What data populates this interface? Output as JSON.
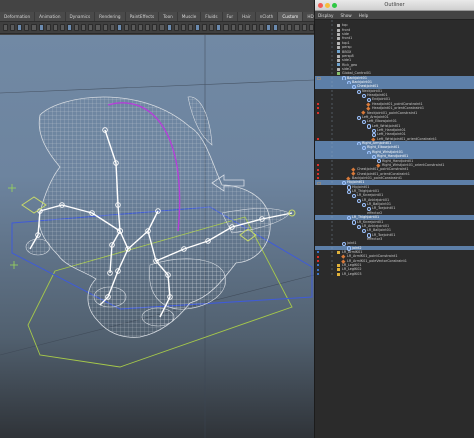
{
  "maya": {
    "shelf_tabs": [
      {
        "label": "Deformation",
        "active": false
      },
      {
        "label": "Animation",
        "active": false
      },
      {
        "label": "Dynamics",
        "active": false
      },
      {
        "label": "Rendering",
        "active": false
      },
      {
        "label": "PaintEffects",
        "active": false
      },
      {
        "label": "Toon",
        "active": false
      },
      {
        "label": "Muscle",
        "active": false
      },
      {
        "label": "Fluids",
        "active": false
      },
      {
        "label": "Fur",
        "active": false
      },
      {
        "label": "Hair",
        "active": false
      },
      {
        "label": "nCloth",
        "active": false
      },
      {
        "label": "Custom",
        "active": true
      },
      {
        "label": "HDRLightStudio",
        "active": false
      }
    ],
    "viewport": {
      "bg_top": "#7189a4",
      "bg_bottom": "#2f3338",
      "mesh_color": "#c9ced4",
      "joint_color": "#ffffff",
      "control_green": "#c7d96a",
      "control_blue": "#3f5bd8",
      "control_purple": "#b43fd8"
    }
  },
  "outliner": {
    "title": "Outliner",
    "menu": [
      "Display",
      "Show",
      "Help"
    ],
    "selection_color": "#5d7fa8",
    "rows": [
      {
        "label": "",
        "indent": 0,
        "icon": "none",
        "mk": "",
        "sel": false
      },
      {
        "label": "top",
        "indent": 0,
        "icon": "cam",
        "mk": "",
        "sel": false
      },
      {
        "label": "front",
        "indent": 0,
        "icon": "cam",
        "mk": "",
        "sel": false
      },
      {
        "label": "side",
        "indent": 0,
        "icon": "cam",
        "mk": "",
        "sel": false
      },
      {
        "label": "front1",
        "indent": 0,
        "icon": "cam",
        "mk": "",
        "sel": false
      },
      {
        "label": "top1",
        "indent": 0,
        "icon": "cam",
        "mk": "",
        "sel": false
      },
      {
        "label": "persp",
        "indent": 0,
        "icon": "cam",
        "mk": "",
        "sel": false
      },
      {
        "label": "BBOX",
        "indent": 0,
        "icon": "mesh",
        "mk": "",
        "sel": false
      },
      {
        "label": "persp8",
        "indent": 0,
        "icon": "cam",
        "mk": "",
        "sel": false
      },
      {
        "label": "side1",
        "indent": 0,
        "icon": "cam",
        "mk": "",
        "sel": false
      },
      {
        "label": "Rick_geo",
        "indent": 0,
        "icon": "mesh",
        "mk": "",
        "sel": false
      },
      {
        "label": "side1",
        "indent": 0,
        "icon": "cam",
        "mk": "",
        "sel": false
      },
      {
        "label": "Global_Control01",
        "indent": 0,
        "icon": "ctrl",
        "mk": "",
        "sel": false
      },
      {
        "label": "Backjoint01",
        "indent": 1,
        "icon": "joint",
        "mk": "box",
        "sel": true
      },
      {
        "label": "Backjoint01",
        "indent": 2,
        "icon": "joint",
        "mk": "",
        "sel": true
      },
      {
        "label": "Chestjoint01",
        "indent": 3,
        "icon": "joint",
        "mk": "",
        "sel": true
      },
      {
        "label": "Neckjoint01",
        "indent": 4,
        "icon": "joint",
        "mk": "",
        "sel": false
      },
      {
        "label": "Headjoint01",
        "indent": 5,
        "icon": "joint",
        "mk": "",
        "sel": false
      },
      {
        "label": "Endjoint01",
        "indent": 6,
        "icon": "joint",
        "mk": "",
        "sel": false
      },
      {
        "label": "Headjoint01_pointConstraint1",
        "indent": 6,
        "icon": "con",
        "mk": "red",
        "sel": false
      },
      {
        "label": "Headjoint01_orientConstraint1",
        "indent": 6,
        "icon": "con",
        "mk": "red",
        "sel": false
      },
      {
        "label": "Neckjoint01_pointConstraint1",
        "indent": 5,
        "icon": "con",
        "mk": "red",
        "sel": false
      },
      {
        "label": "Left_Armjoint01",
        "indent": 4,
        "icon": "joint",
        "mk": "",
        "sel": false
      },
      {
        "label": "Left_Elbowjoint01",
        "indent": 5,
        "icon": "joint",
        "mk": "",
        "sel": false
      },
      {
        "label": "Left_Wristjoint01",
        "indent": 6,
        "icon": "joint",
        "mk": "",
        "sel": false
      },
      {
        "label": "Left_Handjoint01",
        "indent": 7,
        "icon": "joint",
        "mk": "",
        "sel": false
      },
      {
        "label": "Left_Handjoint01",
        "indent": 7,
        "icon": "joint",
        "mk": "",
        "sel": false
      },
      {
        "label": "Left_Wristjoint01_orientConstraint1",
        "indent": 7,
        "icon": "con",
        "mk": "red",
        "sel": false
      },
      {
        "label": "Right_Armjoint01",
        "indent": 4,
        "icon": "joint",
        "mk": "",
        "sel": true
      },
      {
        "label": "Right_Elbowjoint01",
        "indent": 5,
        "icon": "joint",
        "mk": "",
        "sel": true
      },
      {
        "label": "Right_Wristjoint01",
        "indent": 6,
        "icon": "joint",
        "mk": "",
        "sel": true
      },
      {
        "label": "Right_Handjoint01",
        "indent": 7,
        "icon": "joint",
        "mk": "",
        "sel": true
      },
      {
        "label": "Right_Handjoint01",
        "indent": 8,
        "icon": "joint",
        "mk": "",
        "sel": false
      },
      {
        "label": "Right_Wristjoint01_orientConstraint1",
        "indent": 8,
        "icon": "con",
        "mk": "red",
        "sel": false
      },
      {
        "label": "Chestjoint01_pointConstraint1",
        "indent": 3,
        "icon": "con",
        "mk": "red",
        "sel": false
      },
      {
        "label": "Chestjoint01_orientConstraint1",
        "indent": 3,
        "icon": "con",
        "mk": "red",
        "sel": false
      },
      {
        "label": "Backjoint01_pointConstraint1",
        "indent": 2,
        "icon": "con",
        "mk": "red",
        "sel": false
      },
      {
        "label": "Hipjoint01",
        "indent": 1,
        "icon": "joint",
        "mk": "box",
        "sel": true
      },
      {
        "label": "Hipjoint01",
        "indent": 2,
        "icon": "joint",
        "mk": "",
        "sel": false
      },
      {
        "label": "LR_Thighjoint01",
        "indent": 2,
        "icon": "joint",
        "mk": "",
        "sel": false
      },
      {
        "label": "LR_Kneejoint01",
        "indent": 3,
        "icon": "joint",
        "mk": "",
        "sel": false
      },
      {
        "label": "LR_Anklejoint01",
        "indent": 4,
        "icon": "joint",
        "mk": "",
        "sel": false
      },
      {
        "label": "LR_Balljoint01",
        "indent": 5,
        "icon": "joint",
        "mk": "",
        "sel": false
      },
      {
        "label": "LR_Toejoint01",
        "indent": 6,
        "icon": "joint",
        "mk": "",
        "sel": false
      },
      {
        "label": "effector2",
        "indent": 5,
        "icon": "none",
        "mk": "",
        "sel": false
      },
      {
        "label": "LR_Thighjoint01",
        "indent": 2,
        "icon": "joint",
        "mk": "",
        "sel": true
      },
      {
        "label": "LR_Kneejoint01",
        "indent": 3,
        "icon": "joint",
        "mk": "",
        "sel": false
      },
      {
        "label": "LR_Anklejoint01",
        "indent": 4,
        "icon": "joint",
        "mk": "",
        "sel": false
      },
      {
        "label": "LR_Balljoint01",
        "indent": 5,
        "icon": "joint",
        "mk": "",
        "sel": false
      },
      {
        "label": "LR_Toejoint01",
        "indent": 6,
        "icon": "joint",
        "mk": "",
        "sel": false
      },
      {
        "label": "effector3",
        "indent": 5,
        "icon": "none",
        "mk": "",
        "sel": false
      },
      {
        "label": "joint1",
        "indent": 1,
        "icon": "joint",
        "mk": "",
        "sel": false
      },
      {
        "label": "joint2",
        "indent": 2,
        "icon": "joint",
        "mk": "",
        "sel": true
      },
      {
        "label": "LR_ArmIK01",
        "indent": 0,
        "icon": "hik",
        "mk": "blue",
        "sel": false
      },
      {
        "label": "LR_ArmIK01_pointConstraint1",
        "indent": 1,
        "icon": "con",
        "mk": "red",
        "sel": false
      },
      {
        "label": "LR_ArmIK01_poleVectorConstraint1",
        "indent": 1,
        "icon": "con",
        "mk": "red",
        "sel": false
      },
      {
        "label": "LR_LegIK01",
        "indent": 0,
        "icon": "hik",
        "mk": "blue",
        "sel": false
      },
      {
        "label": "LR_LegIK02",
        "indent": 0,
        "icon": "hik",
        "mk": "blue",
        "sel": false
      },
      {
        "label": "LR_LegIK03",
        "indent": 0,
        "icon": "hik",
        "mk": "blue",
        "sel": false
      }
    ]
  }
}
